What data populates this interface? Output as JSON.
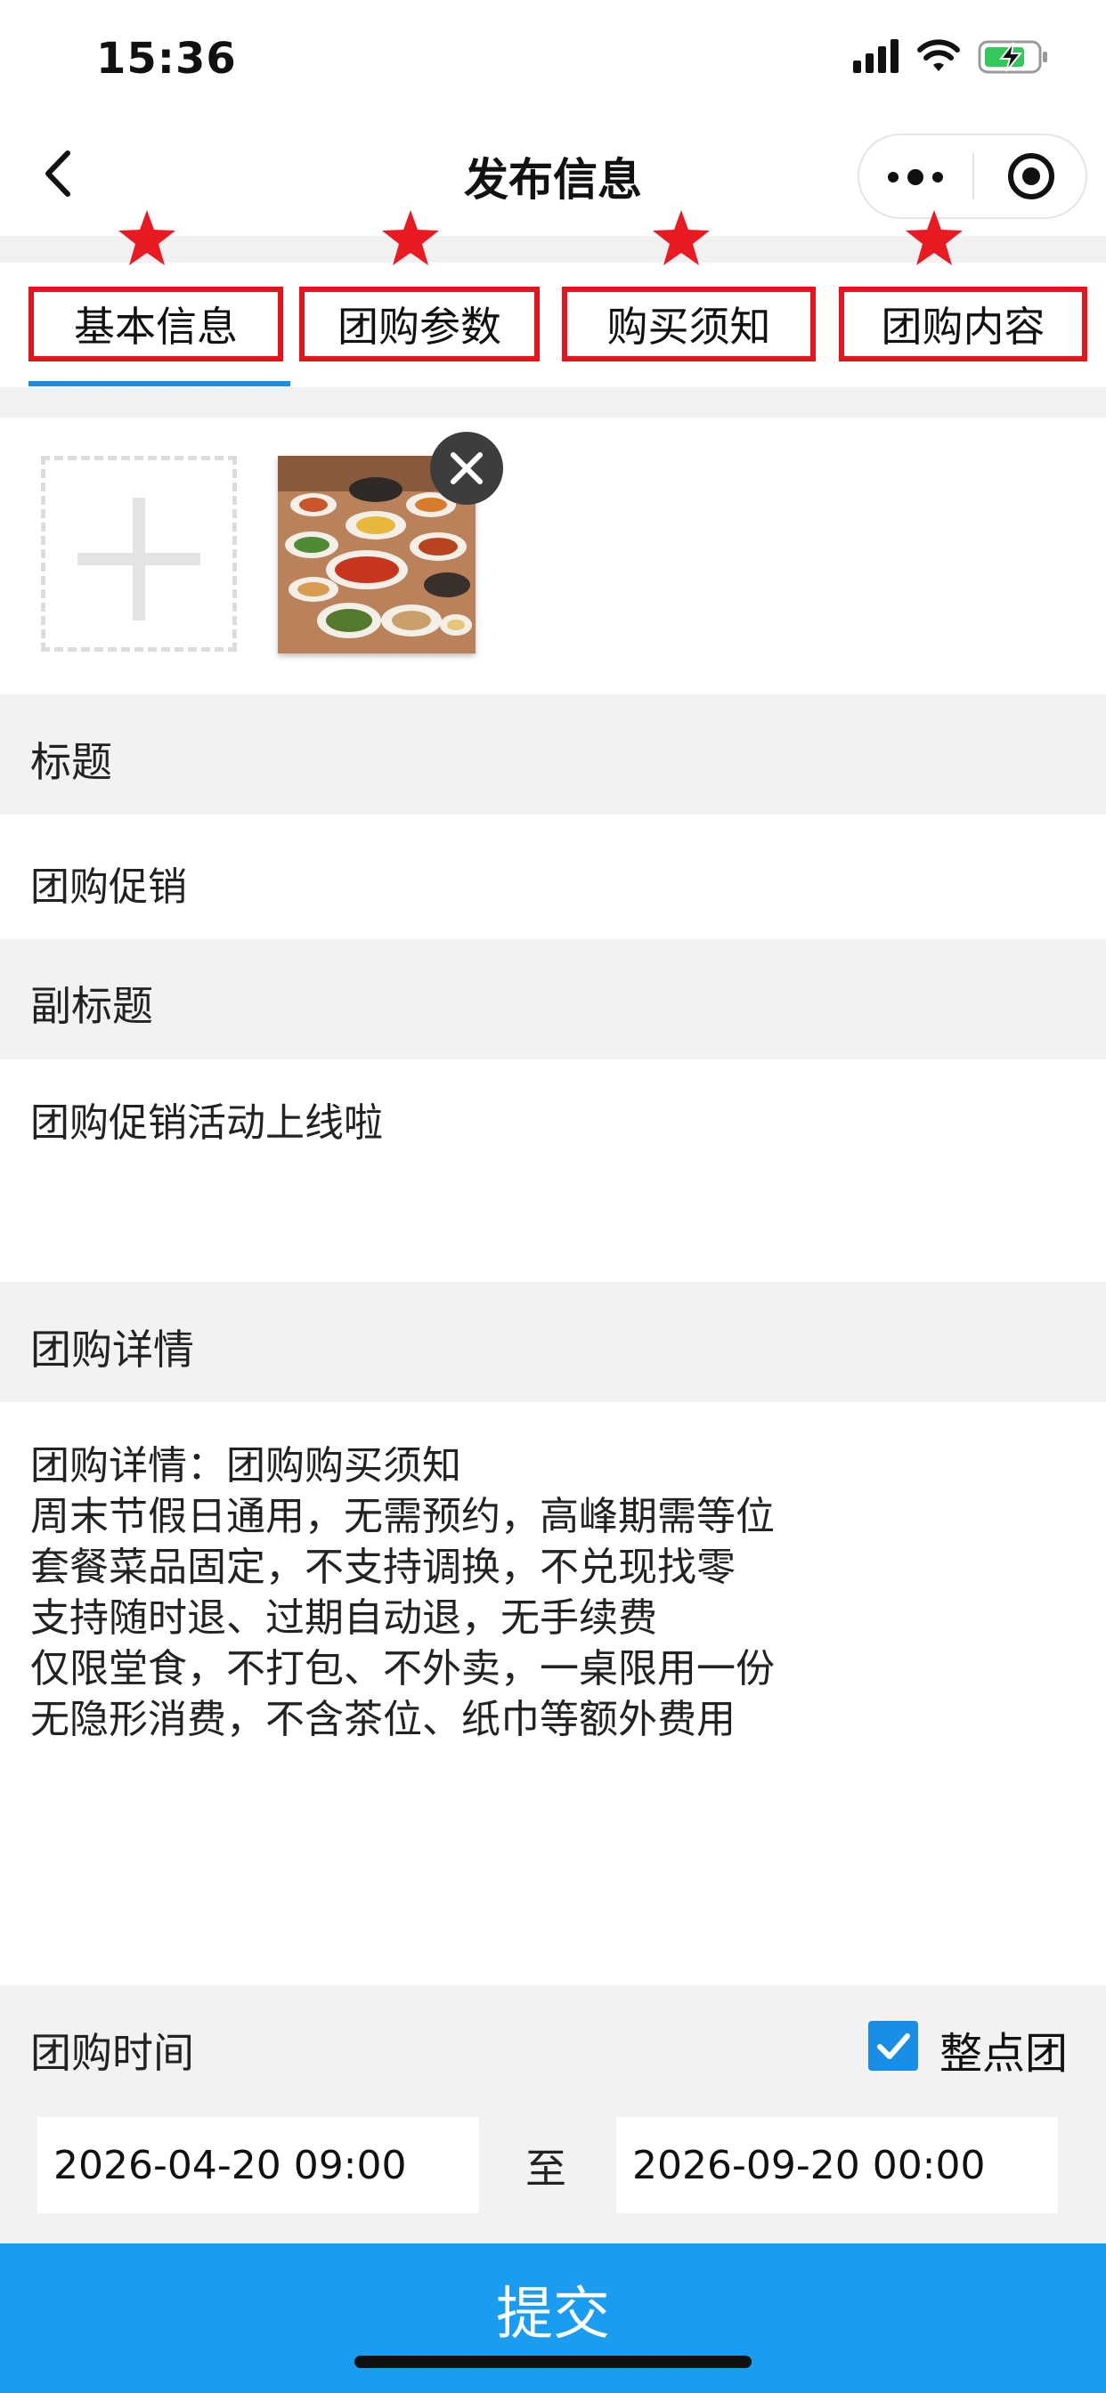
{
  "status_bar": {
    "time": "15:36",
    "icons": [
      "signal-icon",
      "wifi-icon",
      "battery-charging-icon"
    ]
  },
  "nav": {
    "title": "发布信息",
    "back_icon": "chevron-left-icon",
    "more_icon": "more-dots-icon",
    "target_icon": "target-icon"
  },
  "tabs": [
    {
      "label": "基本信息",
      "active": true
    },
    {
      "label": "团购参数",
      "active": false
    },
    {
      "label": "购买须知",
      "active": false
    },
    {
      "label": "团购内容",
      "active": false
    }
  ],
  "colors": {
    "accent": "#1a8ee6",
    "highlight_box": "#e5141d",
    "star": "#ea1a22",
    "submit": "#1a9cf0"
  },
  "uploader": {
    "add_icon": "plus-icon",
    "remove_icon": "close-icon",
    "image_count": 1
  },
  "form": {
    "title_label": "标题",
    "title_value": "团购促销",
    "subtitle_label": "副标题",
    "subtitle_value": "团购促销活动上线啦",
    "details_label": "团购详情",
    "details_lines": [
      "团购详情：团购购买须知",
      "周末节假日通用，无需预约，高峰期需等位",
      "套餐菜品固定，不支持调换，不兑现找零",
      "支持随时退、过期自动退，无手续费",
      "仅限堂食，不打包、不外卖，一桌限用一份",
      "无隐形消费，不含茶位、纸巾等额外费用"
    ],
    "time_label": "团购时间",
    "on_the_hour_label": "整点团",
    "on_the_hour_checked": true,
    "start_time": "2026-04-20 09:00",
    "separator": "至",
    "end_time": "2026-09-20 00:00"
  },
  "submit_label": "提交"
}
